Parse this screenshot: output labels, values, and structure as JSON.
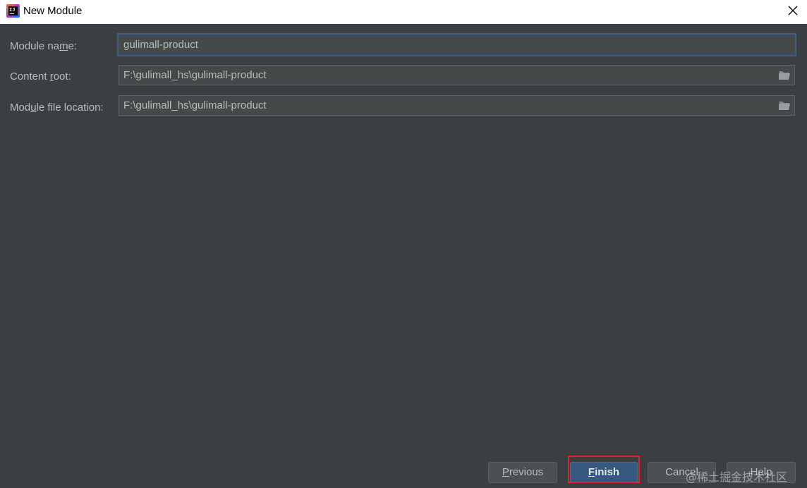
{
  "window": {
    "title": "New Module"
  },
  "form": {
    "module_name": {
      "label_pre": "Module na",
      "label_mnemonic": "m",
      "label_post": "e:",
      "value": "gulimall-product"
    },
    "content_root": {
      "label_pre": "Content ",
      "label_mnemonic": "r",
      "label_post": "oot:",
      "value": "F:\\gulimall_hs\\gulimall-product"
    },
    "module_file_location": {
      "label_pre": "Mod",
      "label_mnemonic": "u",
      "label_post": "le file location:",
      "value": "F:\\gulimall_hs\\gulimall-product"
    }
  },
  "buttons": {
    "previous": {
      "mnemonic": "P",
      "rest": "revious"
    },
    "finish": {
      "mnemonic": "F",
      "rest": "inish"
    },
    "cancel": {
      "label": "Cancel"
    },
    "help": {
      "label": "Help"
    }
  },
  "watermark": "@稀土掘金技术社区",
  "colors": {
    "background": "#3c3f41",
    "field_bg": "#45494a",
    "focus_border": "#3d6185",
    "default_button": "#365880",
    "highlight": "#e0222e"
  }
}
